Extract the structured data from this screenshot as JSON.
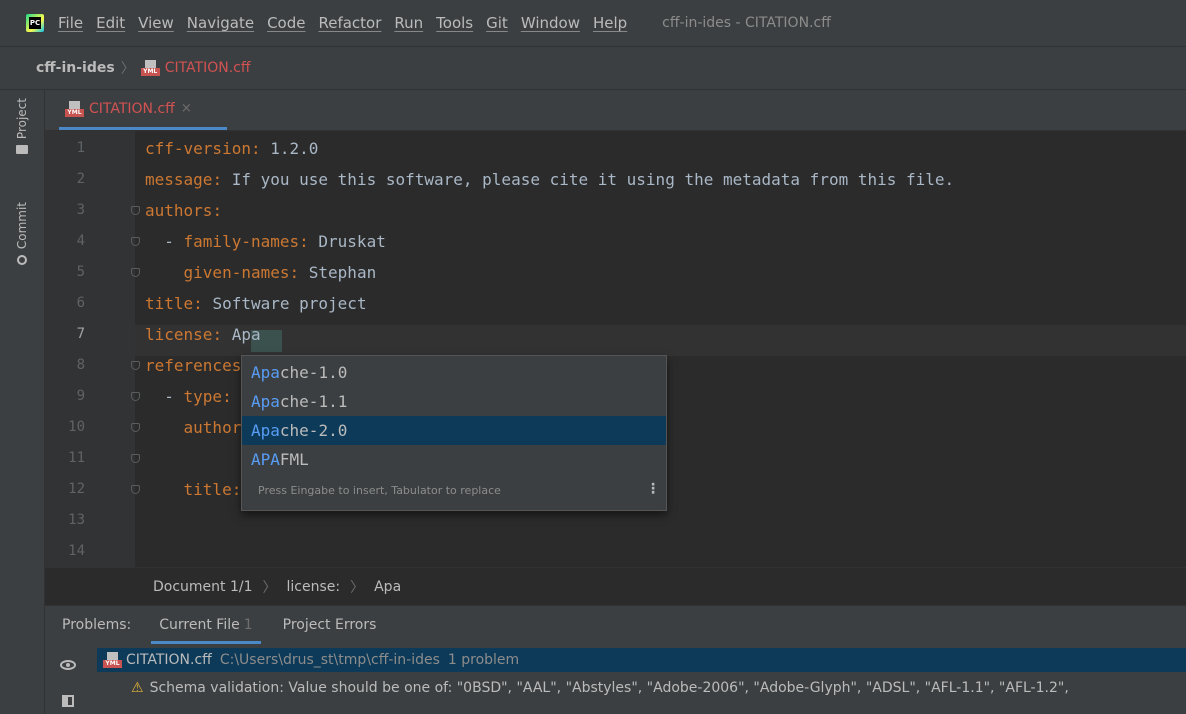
{
  "menubar": {
    "items": [
      "File",
      "Edit",
      "View",
      "Navigate",
      "Code",
      "Refactor",
      "Run",
      "Tools",
      "Git",
      "Window",
      "Help"
    ],
    "window_title": "cff-in-ides - CITATION.cff",
    "logo_text": "PC"
  },
  "navbar": {
    "project": "cff-in-ides",
    "separator": "〉",
    "file": "CITATION.cff"
  },
  "left_stripe": {
    "project_label": "Project",
    "commit_label": "Commit"
  },
  "file_icon_label": "YML",
  "editor_tab": {
    "label": "CITATION.cff",
    "close": "×"
  },
  "editor": {
    "lines": [
      {
        "n": "1",
        "key": "cff-version",
        "value": " 1.2.0",
        "indent": ""
      },
      {
        "n": "2",
        "key": "message",
        "value": " If you use this software, please cite it using the metadata from this file.",
        "indent": ""
      },
      {
        "n": "3",
        "key": "authors",
        "value": "",
        "indent": ""
      },
      {
        "n": "4",
        "key": "family-names",
        "value": " Druskat",
        "indent": "  - "
      },
      {
        "n": "5",
        "key": "given-names",
        "value": " Stephan",
        "indent": "    "
      },
      {
        "n": "6",
        "key": "title",
        "value": " Software project",
        "indent": ""
      },
      {
        "n": "7",
        "key": "license",
        "value": " Apa",
        "indent": ""
      },
      {
        "n": "8",
        "key": "references",
        "value": "",
        "indent": ""
      },
      {
        "n": "9",
        "key": "type",
        "value": "",
        "indent": "  - "
      },
      {
        "n": "10",
        "key": "authors",
        "value": "",
        "indent": "    "
      },
      {
        "n": "11",
        "key": "",
        "value": "",
        "indent": ""
      },
      {
        "n": "12",
        "key": "title",
        "value": "",
        "indent": "    "
      },
      {
        "n": "13",
        "key": "",
        "value": "",
        "indent": ""
      },
      {
        "n": "14",
        "key": "",
        "value": "",
        "indent": ""
      }
    ],
    "current_line": "7"
  },
  "completion": {
    "items": [
      {
        "match": "Apa",
        "rest": "che-1.0"
      },
      {
        "match": "Apa",
        "rest": "che-1.1"
      },
      {
        "match": "Apa",
        "rest": "che-2.0"
      },
      {
        "match": "APA",
        "rest": "FML"
      }
    ],
    "selected_index": 2,
    "hint": "Press Eingabe to insert, Tabulator to replace",
    "more": "⋮"
  },
  "breadcrumbs": {
    "doc": "Document 1/1",
    "separator": "〉",
    "key": "license:",
    "value": "Apa"
  },
  "problems": {
    "title": "Problems:",
    "tab_current": "Current File",
    "tab_current_count": "1",
    "tab_project_errors": "Project Errors",
    "file_name": "CITATION.cff",
    "file_path": "C:\\Users\\drus_st\\tmp\\cff-in-ides",
    "file_count": "1 problem",
    "warning_icon": "⚠",
    "message": "Schema validation: Value should be one of: \"0BSD\", \"AAL\", \"Abstyles\", \"Adobe-2006\", \"Adobe-Glyph\", \"ADSL\", \"AFL-1.1\", \"AFL-1.2\","
  },
  "colors": {
    "accent": "#4a88c7",
    "selection": "#0d3a58",
    "yaml_key": "#cc7832",
    "match": "#589df6"
  }
}
